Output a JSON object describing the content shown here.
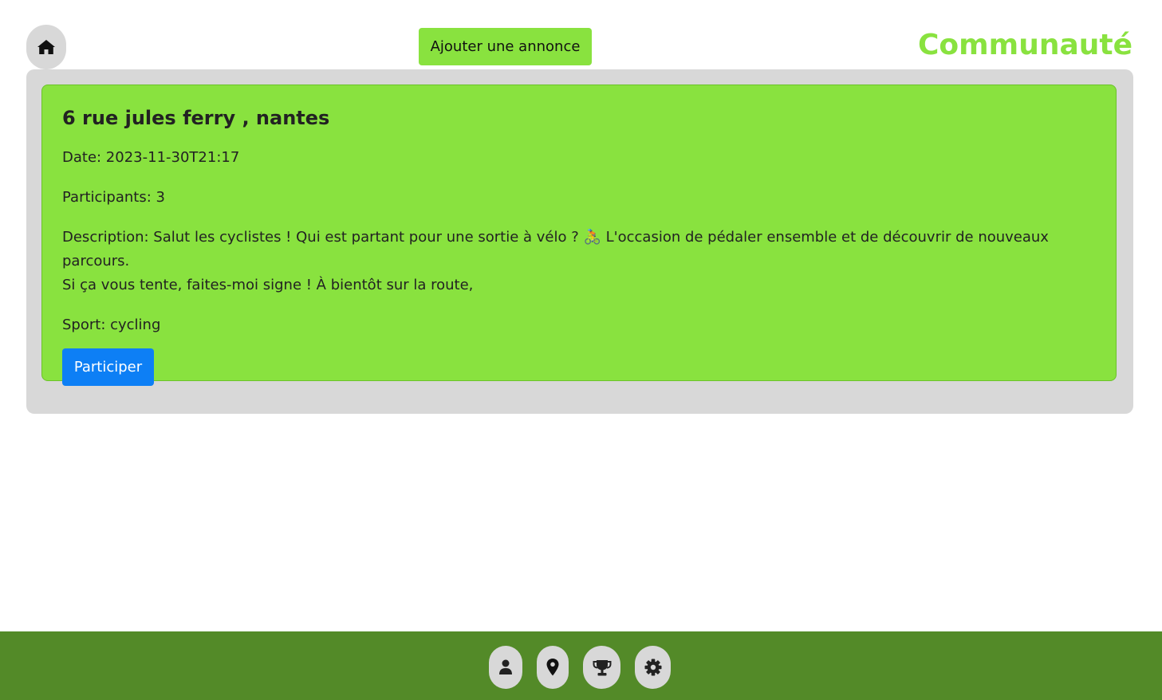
{
  "header": {
    "home_icon": "home-icon",
    "add_button_label": "Ajouter une annonce",
    "title": "Communauté"
  },
  "listing": {
    "title": "6 rue jules ferry , nantes",
    "date": "Date: 2023-11-30T21:17",
    "participants": "Participants: 3",
    "description_line1": "Description: Salut les cyclistes ! Qui est partant pour une sortie à vélo ? 🚴 L'occasion de pédaler ensemble et de découvrir de nouveaux parcours.",
    "description_line2": "Si ça vous tente, faites-moi signe ! À bientôt sur la route,",
    "sport": "Sport: cycling",
    "participate_label": "Participer"
  },
  "footer": {
    "icons": [
      "user-icon",
      "map-pin-icon",
      "trophy-icon",
      "gear-icon"
    ]
  },
  "colors": {
    "accent_green": "#89e23f",
    "footer_green": "#538a28",
    "panel_gray": "#d8d8d8",
    "primary_blue": "#0d7ff5"
  }
}
